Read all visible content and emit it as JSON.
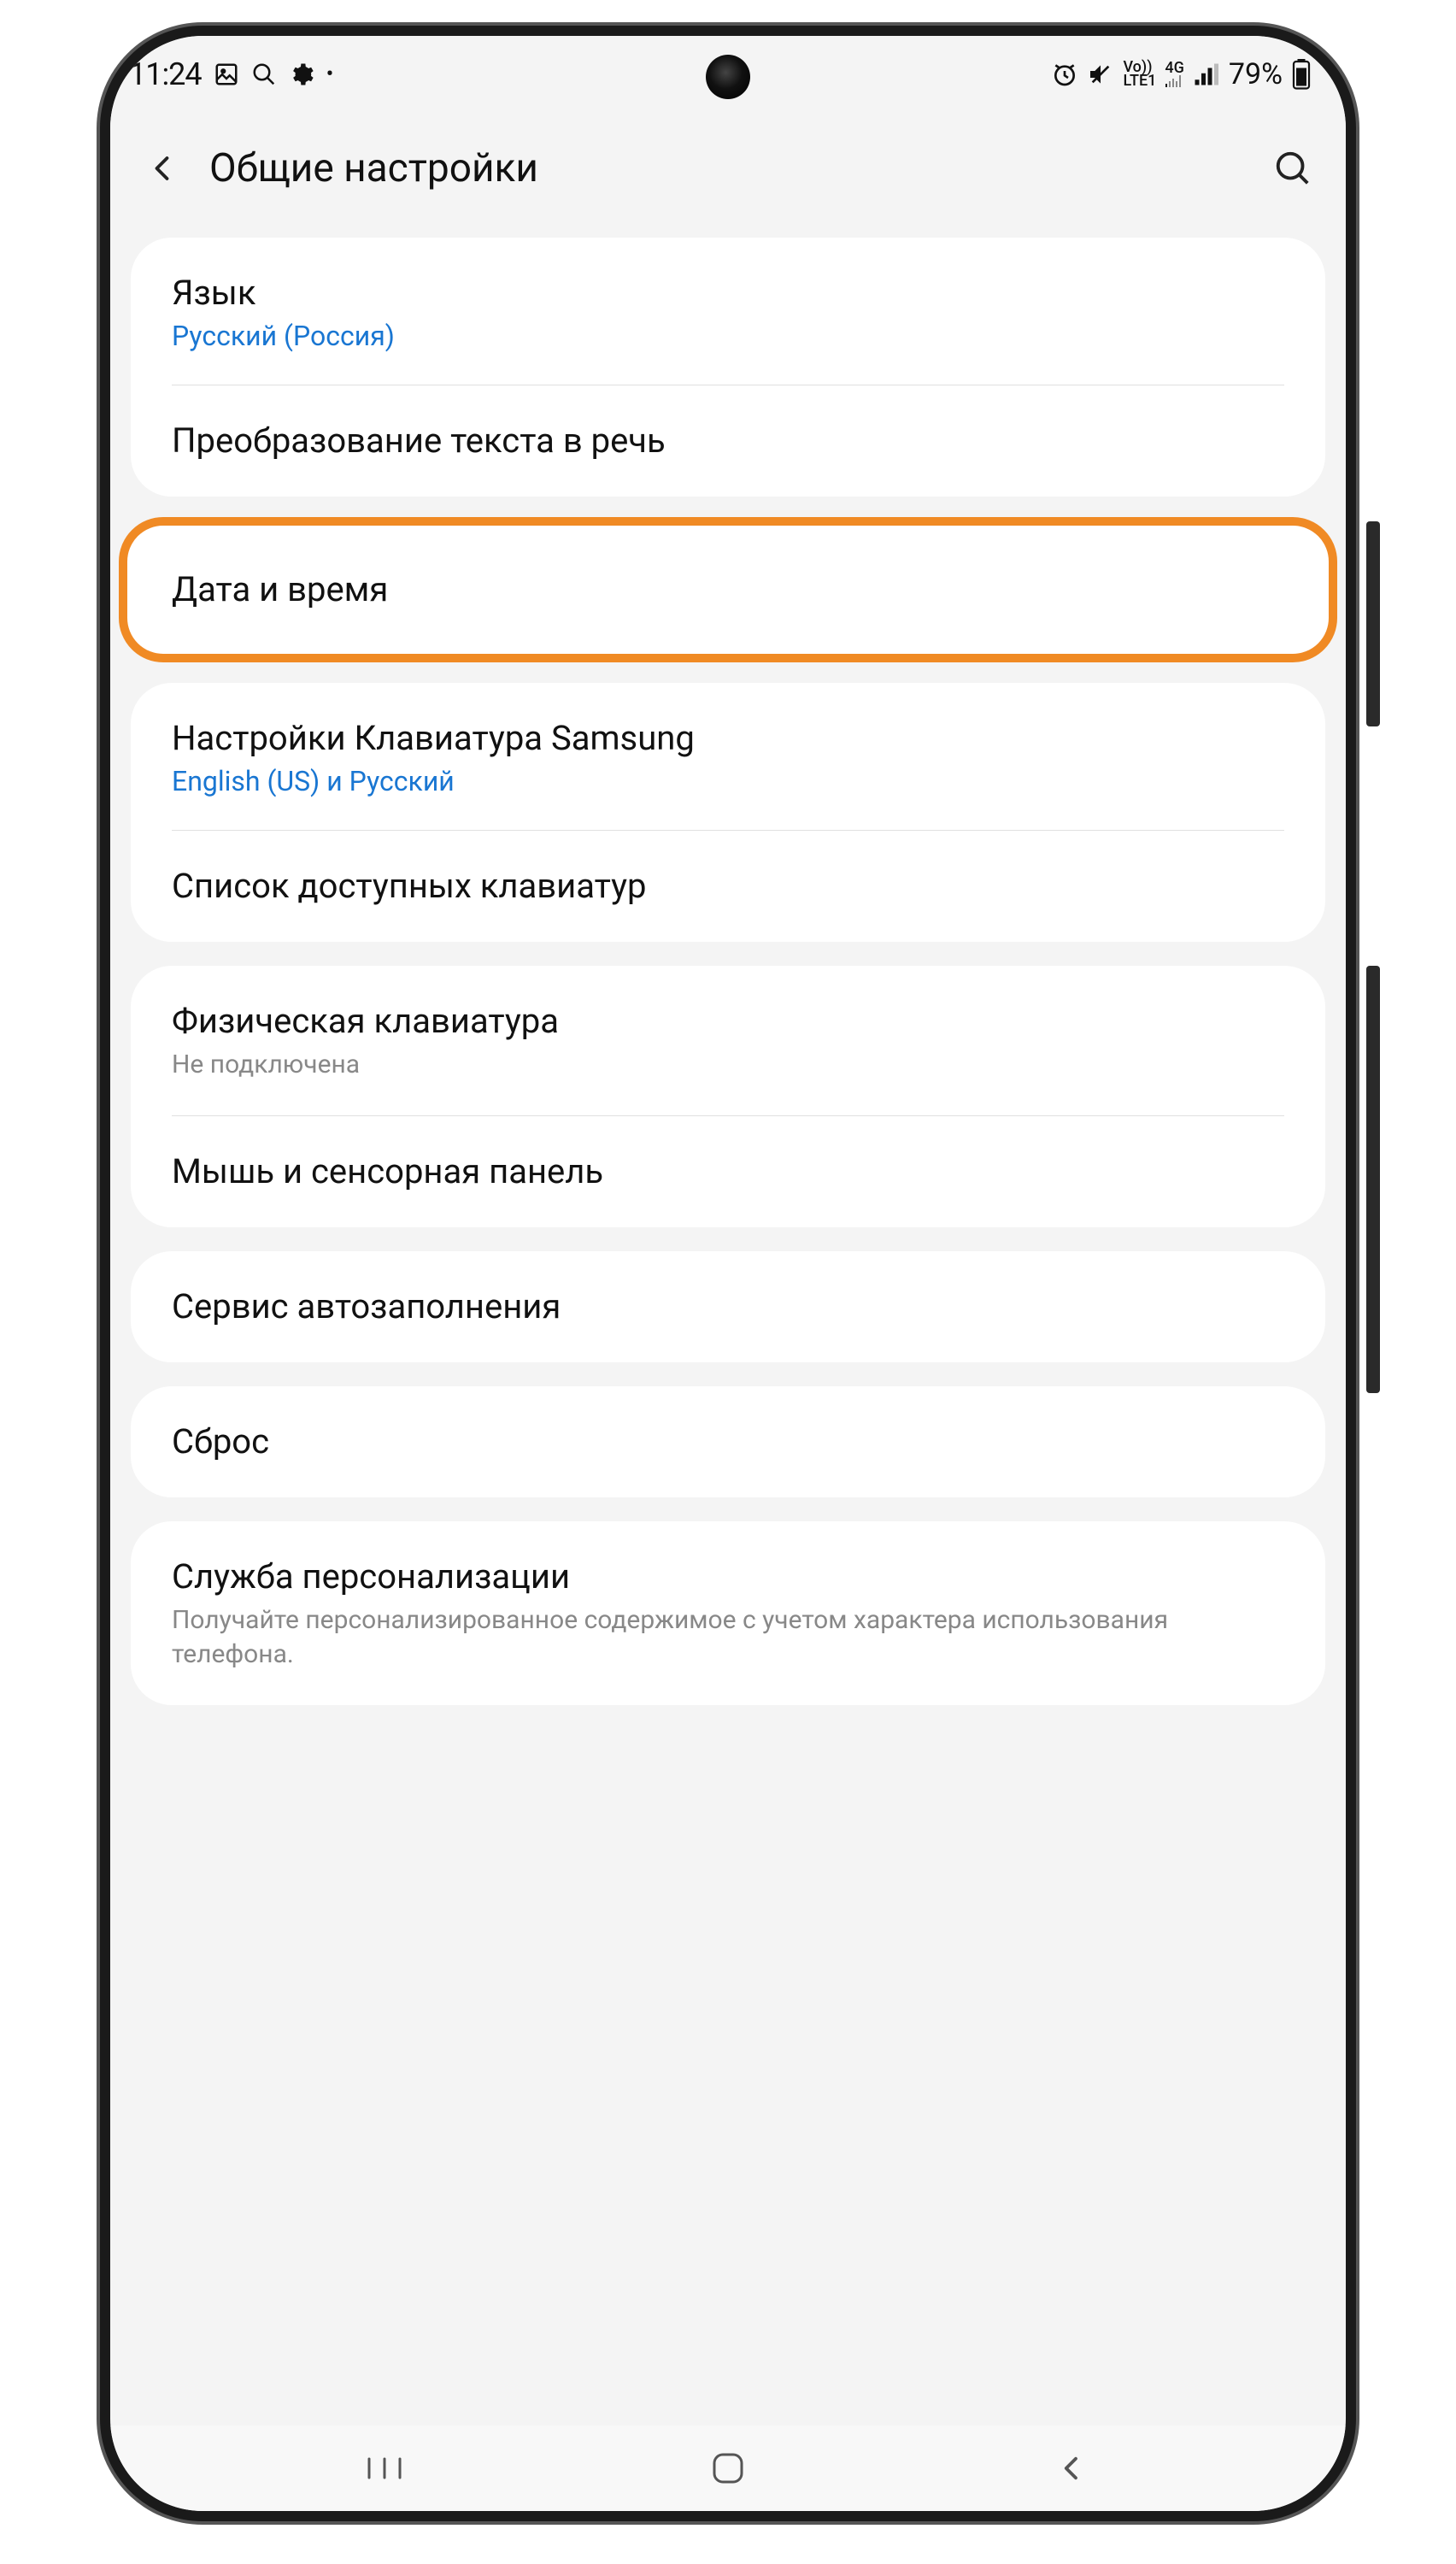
{
  "status": {
    "time": "11:24",
    "battery": "79%",
    "lte_top": "Vo))",
    "lte_bot": "LTE1",
    "net": "4G"
  },
  "header": {
    "title": "Общие настройки"
  },
  "groups": [
    {
      "highlight": false,
      "items": [
        {
          "title": "Язык",
          "sub_blue": "Русский (Россия)"
        },
        {
          "title": "Преобразование текста в речь"
        }
      ]
    },
    {
      "highlight": true,
      "items": [
        {
          "title": "Дата и время"
        }
      ]
    },
    {
      "highlight": false,
      "items": [
        {
          "title": "Настройки Клавиатура Samsung",
          "sub_blue": "English (US) и Русский"
        },
        {
          "title": "Список доступных клавиатур"
        }
      ]
    },
    {
      "highlight": false,
      "items": [
        {
          "title": "Физическая клавиатура",
          "sub_gray": "Не подключена"
        },
        {
          "title": "Мышь и сенсорная панель"
        }
      ]
    },
    {
      "highlight": false,
      "items": [
        {
          "title": "Сервис автозаполнения"
        }
      ]
    },
    {
      "highlight": false,
      "items": [
        {
          "title": "Сброс"
        }
      ]
    },
    {
      "highlight": false,
      "items": [
        {
          "title": "Служба персонализации",
          "sub_gray": "Получайте персонализированное содержимое с учетом характера использования телефона."
        }
      ]
    }
  ]
}
